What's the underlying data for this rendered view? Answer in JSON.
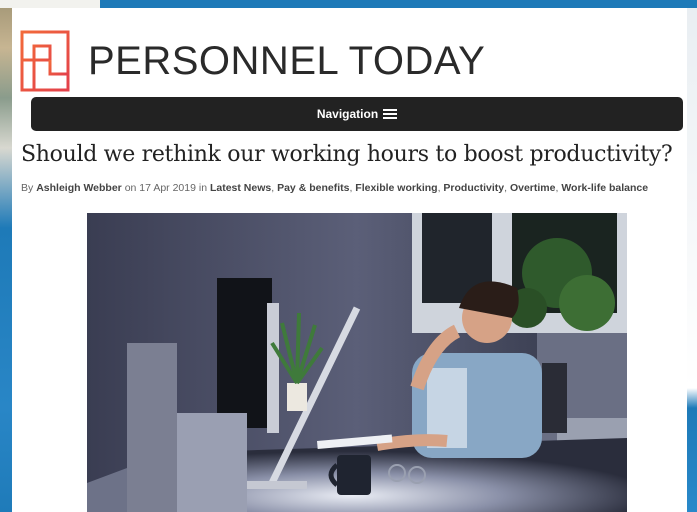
{
  "site": {
    "name": "PERSONNEL TODAY",
    "logo_icon": "personnel-today-logo",
    "brand_color": "#e8553a"
  },
  "nav": {
    "label": "Navigation",
    "icon": "hamburger-menu-icon"
  },
  "article": {
    "title": "Should we rethink our working hours to boost productivity?",
    "byline": {
      "prefix": "By",
      "author": "Ashleigh Webber",
      "date_prefix": "on",
      "date": "17 Apr 2019",
      "in": "in",
      "categories": [
        "Latest News",
        "Pay & benefits",
        "Flexible working",
        "Productivity",
        "Overtime",
        "Work-life balance"
      ],
      "sep": ","
    },
    "image_alt": "Tired man yawning at desk in front of computer at night"
  },
  "colors": {
    "nav_bg": "#222222",
    "page_bg": "#1b6fa8",
    "card_bg": "#ffffff"
  }
}
